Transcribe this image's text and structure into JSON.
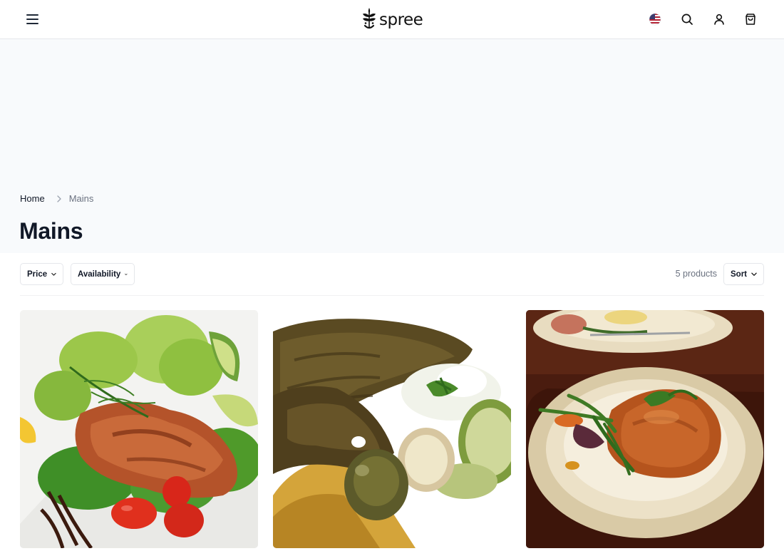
{
  "header": {
    "menu_icon": "hamburger-menu-icon",
    "logo_text": "spree",
    "icons": [
      "us-flag-icon",
      "search-icon",
      "account-icon",
      "cart-icon"
    ]
  },
  "breadcrumb": {
    "home": "Home",
    "current": "Mains"
  },
  "page": {
    "title": "Mains"
  },
  "filters": {
    "price_label": "Price",
    "availability_label": "Availability",
    "sort_label": "Sort",
    "product_count": "5 products"
  },
  "products": [
    {
      "image": "grilled salmon with salad and tomatoes"
    },
    {
      "image": "steak with mashed potatoes and zucchini"
    },
    {
      "image": "meat in sauce with green beans on plate"
    }
  ],
  "colors": {
    "hero_bg": "#f8fafc",
    "text": "#111827",
    "muted": "#6b7280",
    "border": "#e5e7eb"
  }
}
